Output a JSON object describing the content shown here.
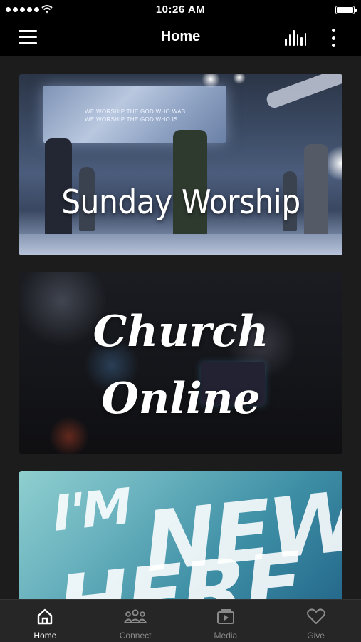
{
  "status_bar": {
    "time": "10:26 AM",
    "signal_icon": "signal-dots-icon",
    "wifi_icon": "wifi-icon",
    "battery_icon": "battery-icon",
    "battery_level": 1.0
  },
  "nav": {
    "title": "Home",
    "menu_icon": "hamburger-menu-icon",
    "stats_icon": "audio-bars-icon",
    "more_icon": "vertical-ellipsis-icon"
  },
  "cards": [
    {
      "title": "Sunday Worship",
      "screen_text": "WE WORSHIP THE GOD WHO WAS\nWE WORSHIP THE GOD WHO IS"
    },
    {
      "title_line1": "Church",
      "title_line2": "Online"
    },
    {
      "title_line1": "I'M",
      "title_line2": "NEW",
      "title_line3": "HERE"
    }
  ],
  "tabs": [
    {
      "label": "Home",
      "icon": "home-icon",
      "active": true
    },
    {
      "label": "Connect",
      "icon": "people-icon",
      "active": false
    },
    {
      "label": "Media",
      "icon": "media-play-icon",
      "active": false
    },
    {
      "label": "Give",
      "icon": "heart-icon",
      "active": false
    }
  ],
  "colors": {
    "background": "#1c1c1c",
    "bar": "#000000",
    "tab_bar": "#262626",
    "tab_inactive": "#8a8a8a",
    "tab_active": "#ffffff"
  }
}
